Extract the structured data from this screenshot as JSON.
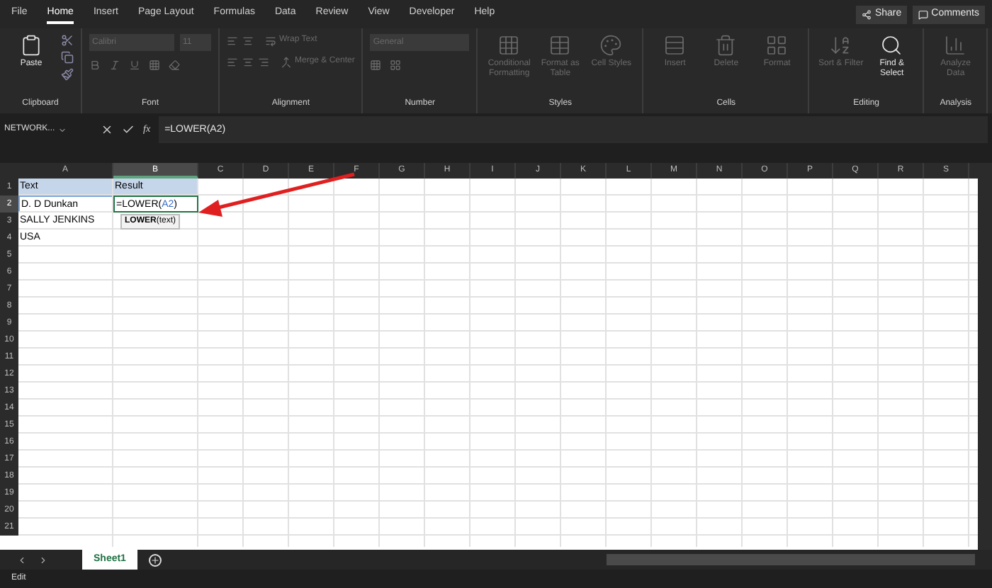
{
  "tabs": [
    {
      "label": "File",
      "selected": false
    },
    {
      "label": "Home",
      "selected": true
    },
    {
      "label": "Insert",
      "selected": false
    },
    {
      "label": "Page Layout",
      "selected": false
    },
    {
      "label": "Formulas",
      "selected": false
    },
    {
      "label": "Data",
      "selected": false
    },
    {
      "label": "Review",
      "selected": false
    },
    {
      "label": "View",
      "selected": false
    },
    {
      "label": "Developer",
      "selected": false
    },
    {
      "label": "Help",
      "selected": false
    }
  ],
  "header_buttons": [
    {
      "kind": "share",
      "label": "Share"
    },
    {
      "kind": "comments",
      "label": "Comments"
    }
  ],
  "ribbon": [
    {
      "label": "Clipboard",
      "controls": [
        {
          "kind": "paste",
          "label": "Paste",
          "disabled": false
        }
      ]
    },
    {
      "label": "Font",
      "controls": [
        {
          "kind": "font",
          "label": "Calibri",
          "disabled": true
        },
        {
          "kind": "size",
          "label": "11",
          "disabled": true
        }
      ]
    },
    {
      "label": "Alignment",
      "controls": [
        {
          "kind": "wrap",
          "label": "Wrap Text",
          "disabled": true
        },
        {
          "kind": "merge",
          "label": "Merge & Center",
          "disabled": true
        }
      ]
    },
    {
      "label": "Number",
      "controls": [
        {
          "kind": "numfmt",
          "label": "General",
          "disabled": true
        }
      ]
    },
    {
      "label": "Styles",
      "controls": [
        {
          "kind": "cond",
          "label": "Conditional Formatting",
          "disabled": true
        },
        {
          "kind": "table",
          "label": "Format as Table",
          "disabled": true
        },
        {
          "kind": "styles",
          "label": "Cell Styles",
          "disabled": true
        }
      ]
    },
    {
      "label": "Cells",
      "controls": [
        {
          "kind": "insert",
          "label": "Insert",
          "disabled": true
        },
        {
          "kind": "delete",
          "label": "Delete",
          "disabled": true
        },
        {
          "kind": "format",
          "label": "Format",
          "disabled": true
        }
      ]
    },
    {
      "label": "Editing",
      "controls": [
        {
          "kind": "sort",
          "label": "Sort & Filter",
          "disabled": true
        },
        {
          "kind": "find",
          "label": "Find & Select",
          "disabled": false
        }
      ]
    },
    {
      "label": "Analysis",
      "controls": [
        {
          "kind": "analyze",
          "label": "Analyze Data",
          "disabled": true
        }
      ]
    }
  ],
  "formula_bar": {
    "name_box": "NETWORK...",
    "fx": "fx",
    "formula": "=LOWER(A2)"
  },
  "columns": [
    {
      "label": "A",
      "selected": false
    },
    {
      "label": "B",
      "selected": true
    },
    {
      "label": "C",
      "selected": false
    },
    {
      "label": "D",
      "selected": false
    },
    {
      "label": "E",
      "selected": false
    },
    {
      "label": "F",
      "selected": false
    },
    {
      "label": "G",
      "selected": false
    },
    {
      "label": "H",
      "selected": false
    },
    {
      "label": "I",
      "selected": false
    },
    {
      "label": "J",
      "selected": false
    },
    {
      "label": "K",
      "selected": false
    },
    {
      "label": "L",
      "selected": false
    },
    {
      "label": "M",
      "selected": false
    },
    {
      "label": "N",
      "selected": false
    },
    {
      "label": "O",
      "selected": false
    },
    {
      "label": "P",
      "selected": false
    },
    {
      "label": "Q",
      "selected": false
    },
    {
      "label": "R",
      "selected": false
    },
    {
      "label": "S",
      "selected": false
    }
  ],
  "rows": [
    {
      "label": "1",
      "selected": false,
      "cells": [
        "Text",
        "Result"
      ]
    },
    {
      "label": "2",
      "selected": true,
      "cells": [
        "D. D Dunkan"
      ]
    },
    {
      "label": "3",
      "selected": false,
      "cells": [
        "SALLY JENKINS"
      ]
    },
    {
      "label": "4",
      "selected": false,
      "cells": [
        "USA"
      ]
    },
    {
      "label": "5",
      "selected": false,
      "cells": []
    },
    {
      "label": "6",
      "selected": false,
      "cells": []
    },
    {
      "label": "7",
      "selected": false,
      "cells": []
    },
    {
      "label": "8",
      "selected": false,
      "cells": []
    },
    {
      "label": "9",
      "selected": false,
      "cells": []
    },
    {
      "label": "10",
      "selected": false,
      "cells": []
    },
    {
      "label": "11",
      "selected": false,
      "cells": []
    },
    {
      "label": "12",
      "selected": false,
      "cells": []
    },
    {
      "label": "13",
      "selected": false,
      "cells": []
    },
    {
      "label": "14",
      "selected": false,
      "cells": []
    },
    {
      "label": "15",
      "selected": false,
      "cells": []
    },
    {
      "label": "16",
      "selected": false,
      "cells": []
    },
    {
      "label": "17",
      "selected": false,
      "cells": []
    },
    {
      "label": "18",
      "selected": false,
      "cells": []
    },
    {
      "label": "19",
      "selected": false,
      "cells": []
    },
    {
      "label": "20",
      "selected": false,
      "cells": []
    },
    {
      "label": "21",
      "selected": false,
      "cells": []
    }
  ],
  "editing_cell": {
    "prefix": "=LOWER(",
    "ref": "A2",
    "suffix": ")",
    "tooltip": "**LOWER**(text)"
  },
  "sheet_tabs": [
    {
      "label": "Sheet1",
      "selected": true
    }
  ],
  "status": "Edit"
}
